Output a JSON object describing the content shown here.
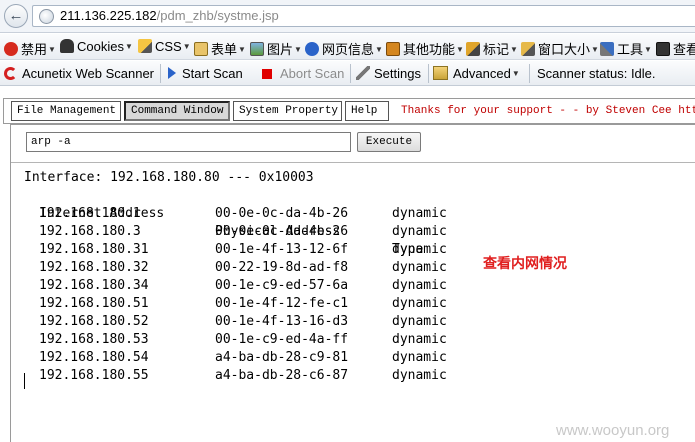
{
  "browser": {
    "url_host": "211.136.225.182",
    "url_path": "/pdm_zhb/systme.jsp"
  },
  "plugin_toolbar": {
    "items": [
      {
        "label": "禁用",
        "icon": "disable-icon"
      },
      {
        "label": "Cookies",
        "icon": "person-icon"
      },
      {
        "label": "CSS",
        "icon": "pencil-icon"
      },
      {
        "label": "表单",
        "icon": "form-icon"
      },
      {
        "label": "图片",
        "icon": "image-icon"
      },
      {
        "label": "网页信息",
        "icon": "info-icon"
      },
      {
        "label": "其他功能",
        "icon": "book-icon"
      },
      {
        "label": "标记",
        "icon": "pen-icon"
      },
      {
        "label": "窗口大小",
        "icon": "ruler-icon"
      },
      {
        "label": "工具",
        "icon": "tools-icon"
      },
      {
        "label": "查看",
        "icon": "monitor-icon"
      }
    ]
  },
  "acunetix_toolbar": {
    "title": "Acunetix Web Scanner",
    "start_scan": "Start Scan",
    "abort_scan": "Abort Scan",
    "settings": "Settings",
    "advanced": "Advanced",
    "status": "Scanner status: Idle."
  },
  "webshell": {
    "menu": [
      {
        "label": "File Management",
        "active": false
      },
      {
        "label": "Command Window",
        "active": true
      },
      {
        "label": "System Property",
        "active": false
      },
      {
        "label": "Help",
        "active": false
      }
    ],
    "thanks": "Thanks for your support - - by Steven Cee http://",
    "command_value": "arp -a",
    "execute_label": "Execute",
    "output_interface": "Interface: 192.168.180.80 --- 0x10003",
    "output_headers": {
      "ip": "Internet Address",
      "mac": "Physical Address",
      "type": "Type"
    },
    "arp_rows": [
      {
        "ip": "192.168.180.1",
        "mac": "00-0e-0c-da-4b-26",
        "type": "dynamic"
      },
      {
        "ip": "192.168.180.3",
        "mac": "00-0e-0c-da-4b-26",
        "type": "dynamic"
      },
      {
        "ip": "192.168.180.31",
        "mac": "00-1e-4f-13-12-6f",
        "type": "dynamic"
      },
      {
        "ip": "192.168.180.32",
        "mac": "00-22-19-8d-ad-f8",
        "type": "dynamic"
      },
      {
        "ip": "192.168.180.34",
        "mac": "00-1e-c9-ed-57-6a",
        "type": "dynamic"
      },
      {
        "ip": "192.168.180.51",
        "mac": "00-1e-4f-12-fe-c1",
        "type": "dynamic"
      },
      {
        "ip": "192.168.180.52",
        "mac": "00-1e-4f-13-16-d3",
        "type": "dynamic"
      },
      {
        "ip": "192.168.180.53",
        "mac": "00-1e-c9-ed-4a-ff",
        "type": "dynamic"
      },
      {
        "ip": "192.168.180.54",
        "mac": "a4-ba-db-28-c9-81",
        "type": "dynamic"
      },
      {
        "ip": "192.168.180.55",
        "mac": "a4-ba-db-28-c6-87",
        "type": "dynamic"
      }
    ]
  },
  "annotation": "查看内网情况",
  "watermark": "www.wooyun.org",
  "colors": {
    "thanks_text": "#c00000",
    "annotation_text": "#e02020",
    "record_icon": "#e00000",
    "play_icon": "#2a63c9"
  }
}
